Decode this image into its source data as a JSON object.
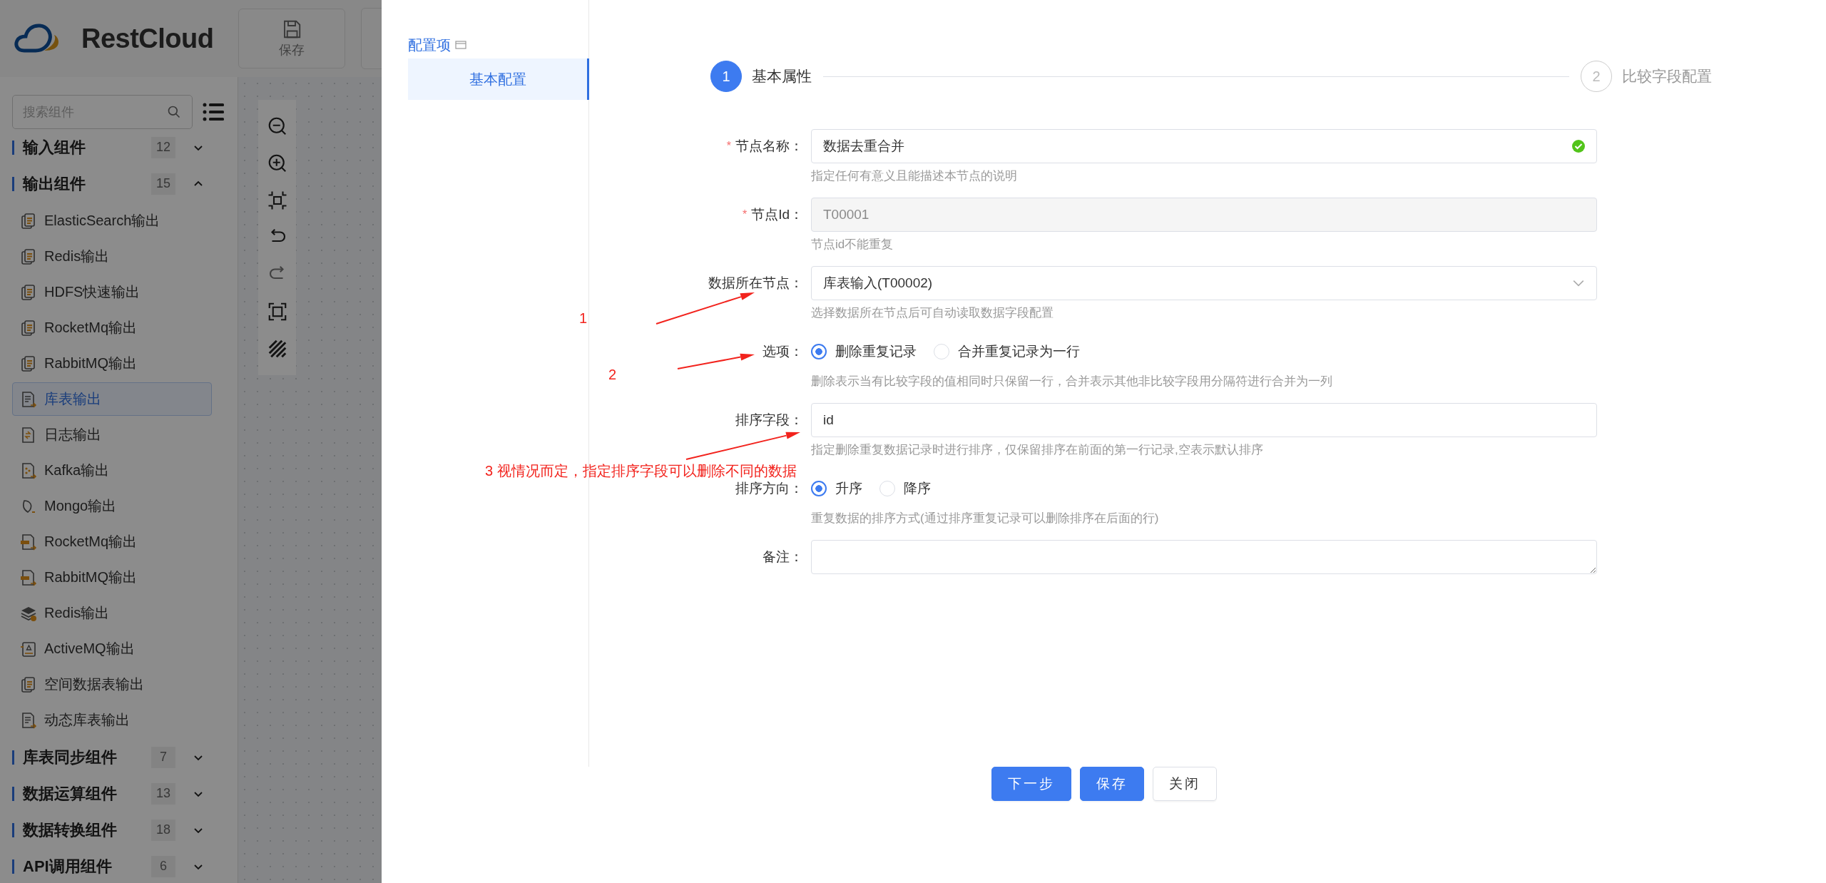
{
  "app": {
    "logo": "RestCloud",
    "toolbar": [
      {
        "label": "保存"
      }
    ],
    "search": {
      "placeholder": "搜索组件"
    },
    "groups": [
      {
        "label": "输入组件",
        "count": "12",
        "expanded": false
      },
      {
        "label": "输出组件",
        "count": "15",
        "expanded": true,
        "items": [
          {
            "label": "ElasticSearch输出",
            "selected": false
          },
          {
            "label": "Redis输出",
            "selected": false
          },
          {
            "label": "HDFS快速输出",
            "selected": false
          },
          {
            "label": "RocketMq输出",
            "selected": false
          },
          {
            "label": "RabbitMQ输出",
            "selected": false
          },
          {
            "label": "库表输出",
            "selected": true
          },
          {
            "label": "日志输出",
            "selected": false
          },
          {
            "label": "Kafka输出",
            "selected": false
          },
          {
            "label": "Mongo输出",
            "selected": false
          },
          {
            "label": "RocketMq输出",
            "selected": false
          },
          {
            "label": "RabbitMQ输出",
            "selected": false
          },
          {
            "label": "Redis输出",
            "selected": false
          },
          {
            "label": "ActiveMQ输出",
            "selected": false
          },
          {
            "label": "空间数据表输出",
            "selected": false
          },
          {
            "label": "动态库表输出",
            "selected": false
          }
        ]
      },
      {
        "label": "库表同步组件",
        "count": "7",
        "expanded": false
      },
      {
        "label": "数据运算组件",
        "count": "13",
        "expanded": false
      },
      {
        "label": "数据转换组件",
        "count": "18",
        "expanded": false
      },
      {
        "label": "API调用组件",
        "count": "6",
        "expanded": false
      }
    ]
  },
  "drawer": {
    "config_title": "配置项",
    "menu": [
      {
        "label": "基本配置",
        "selected": true
      }
    ],
    "steps": [
      {
        "number": "1",
        "label": "基本属性",
        "selected": true
      },
      {
        "number": "2",
        "label": "比较字段配置",
        "selected": false
      }
    ],
    "fields": [
      {
        "kind": "text",
        "required_mark": "*",
        "label": "节点名称：",
        "value": "数据去重合并",
        "valid": true,
        "disabled": false,
        "help": "指定任何有意义且能描述本节点的说明"
      },
      {
        "kind": "text",
        "required_mark": "*",
        "label": "节点Id：",
        "value": "T00001",
        "disabled": true,
        "help": "节点id不能重复"
      },
      {
        "kind": "select",
        "label": "数据所在节点：",
        "value": "库表输入(T00002)",
        "help": "选择数据所在节点后可自动读取数据字段配置"
      },
      {
        "kind": "radio",
        "label": "选项：",
        "options": [
          {
            "label": "删除重复记录",
            "selected": true
          },
          {
            "label": "合并重复记录为一行",
            "selected": false
          }
        ],
        "help": "删除表示当有比较字段的值相同时只保留一行，合并表示其他非比较字段用分隔符进行合并为一列"
      },
      {
        "kind": "text",
        "label": "排序字段：",
        "value": "id",
        "disabled": false,
        "help": "指定删除重复数据记录时进行排序，仅保留排序在前面的第一行记录,空表示默认排序"
      },
      {
        "kind": "radio",
        "label": "排序方向：",
        "options": [
          {
            "label": "升序",
            "selected": true
          },
          {
            "label": "降序",
            "selected": false
          }
        ],
        "help": "重复数据的排序方式(通过排序重复记录可以删除排序在后面的行)"
      },
      {
        "kind": "textarea",
        "label": "备注："
      }
    ],
    "buttons": [
      {
        "label": "下一步",
        "primary": true
      },
      {
        "label": "保存",
        "primary": true
      },
      {
        "label": "关闭",
        "primary": false
      }
    ]
  },
  "annotations": [
    {
      "label": "1"
    },
    {
      "label": "2"
    },
    {
      "label": "3 视情况而定，指定排序字段可以删除不同的数据"
    }
  ]
}
